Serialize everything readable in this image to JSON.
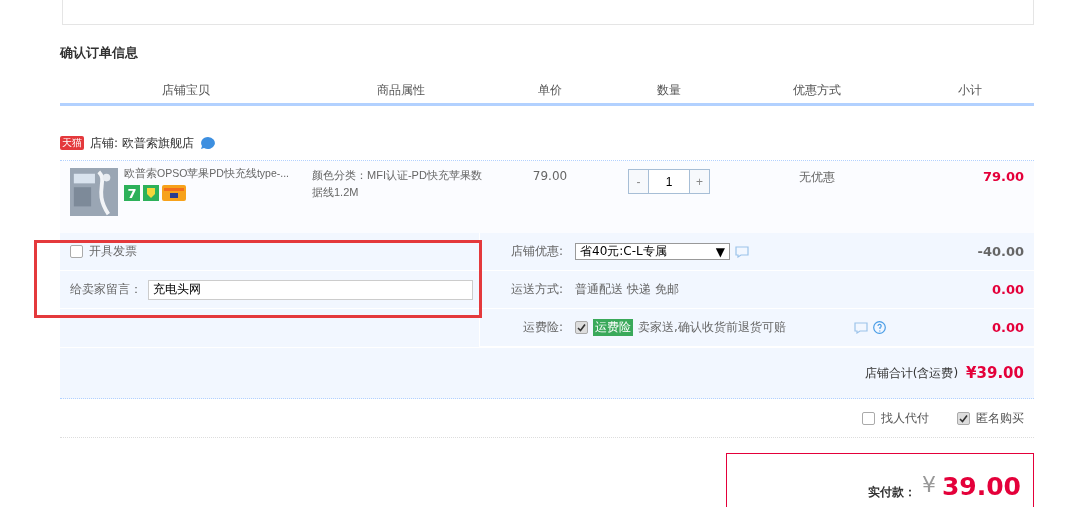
{
  "section_title": "确认订单信息",
  "columns": [
    "店铺宝贝",
    "商品属性",
    "单价",
    "数量",
    "优惠方式",
    "小计"
  ],
  "store": {
    "badge": "天猫",
    "label": "店铺: 欧普索旗舰店"
  },
  "item": {
    "title": "欧普索OPSO苹果PD快充线type-...",
    "attributes": "颜色分类：MFI认证-PD快充苹果数据线1.2M",
    "price": "79.00",
    "quantity": {
      "minus": "-",
      "value": "1",
      "plus": "+"
    },
    "discount": "无优惠",
    "subtotal": "79.00",
    "badges": [
      {
        "kind": "seven",
        "text": "7"
      },
      {
        "kind": "shield"
      },
      {
        "kind": "card"
      }
    ]
  },
  "invoice": {
    "label": "开具发票",
    "checked": false
  },
  "message": {
    "label": "给卖家留言：",
    "value": "充电头网"
  },
  "rows": [
    {
      "kind": "select",
      "label": "店铺优惠:",
      "value": "省40元:C-L专属",
      "arrow": "▼",
      "amount": "-40.00",
      "highlight": false
    },
    {
      "kind": "text",
      "label": "运送方式:",
      "value": "普通配送 快递 免邮",
      "amount": "0.00",
      "highlight": true
    },
    {
      "kind": "insurance",
      "label": "运费险:",
      "checked": true,
      "tag": "运费险",
      "value": "卖家送,确认收货前退货可赔",
      "amount": "0.00",
      "highlight": true
    }
  ],
  "store_total": {
    "label": "店铺合计(含运费)",
    "amount": "¥39.00"
  },
  "options": [
    {
      "label": "找人代付",
      "checked": false
    },
    {
      "label": "匿名购买",
      "checked": true
    }
  ],
  "pay": {
    "label": "实付款：",
    "currency": "¥",
    "amount": "39.00"
  }
}
